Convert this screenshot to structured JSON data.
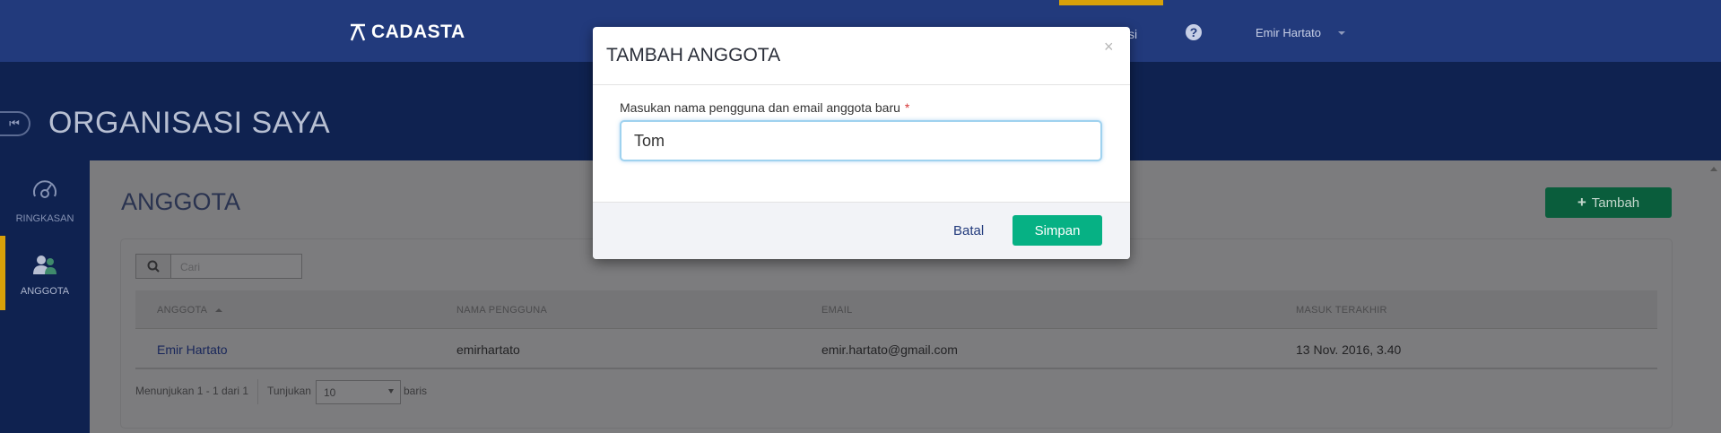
{
  "brand": {
    "name": "CADASTA"
  },
  "nav": {
    "partial_item": "si",
    "help_icon": "?",
    "user_name": "Emir Hartato"
  },
  "page": {
    "title": "ORGANISASI SAYA",
    "collapse_icon": "⏮"
  },
  "sidebar": {
    "items": [
      {
        "label": "RINGKASAN",
        "icon": "dashboard-icon",
        "active": false
      },
      {
        "label": "ANGGOTA",
        "icon": "users-icon",
        "active": true
      }
    ]
  },
  "section": {
    "title": "ANGGOTA",
    "add_label": "Tambah"
  },
  "search": {
    "placeholder": "Cari"
  },
  "table": {
    "columns": [
      "ANGGOTA",
      "NAMA PENGGUNA",
      "EMAIL",
      "MASUK TERAKHIR"
    ],
    "rows": [
      {
        "member": "Emir Hartato",
        "username": "emirhartato",
        "email": "emir.hartato@gmail.com",
        "last_login": "13 Nov. 2016, 3.40"
      }
    ]
  },
  "pagination": {
    "info": "Menunjukan 1 - 1 dari 1",
    "show_label": "Tunjukan",
    "page_size": "10",
    "rows_label": "baris"
  },
  "modal": {
    "title": "TAMBAH ANGGOTA",
    "close": "×",
    "field_label": "Masukan nama pengguna dan email anggota baru",
    "required_mark": "*",
    "input_value": "Tom",
    "cancel_label": "Batal",
    "save_label": "Simpan"
  },
  "colors": {
    "nav": "#223a7c",
    "header": "#0f2250",
    "accent": "#d8a10a",
    "primary_button": "#06b184"
  }
}
